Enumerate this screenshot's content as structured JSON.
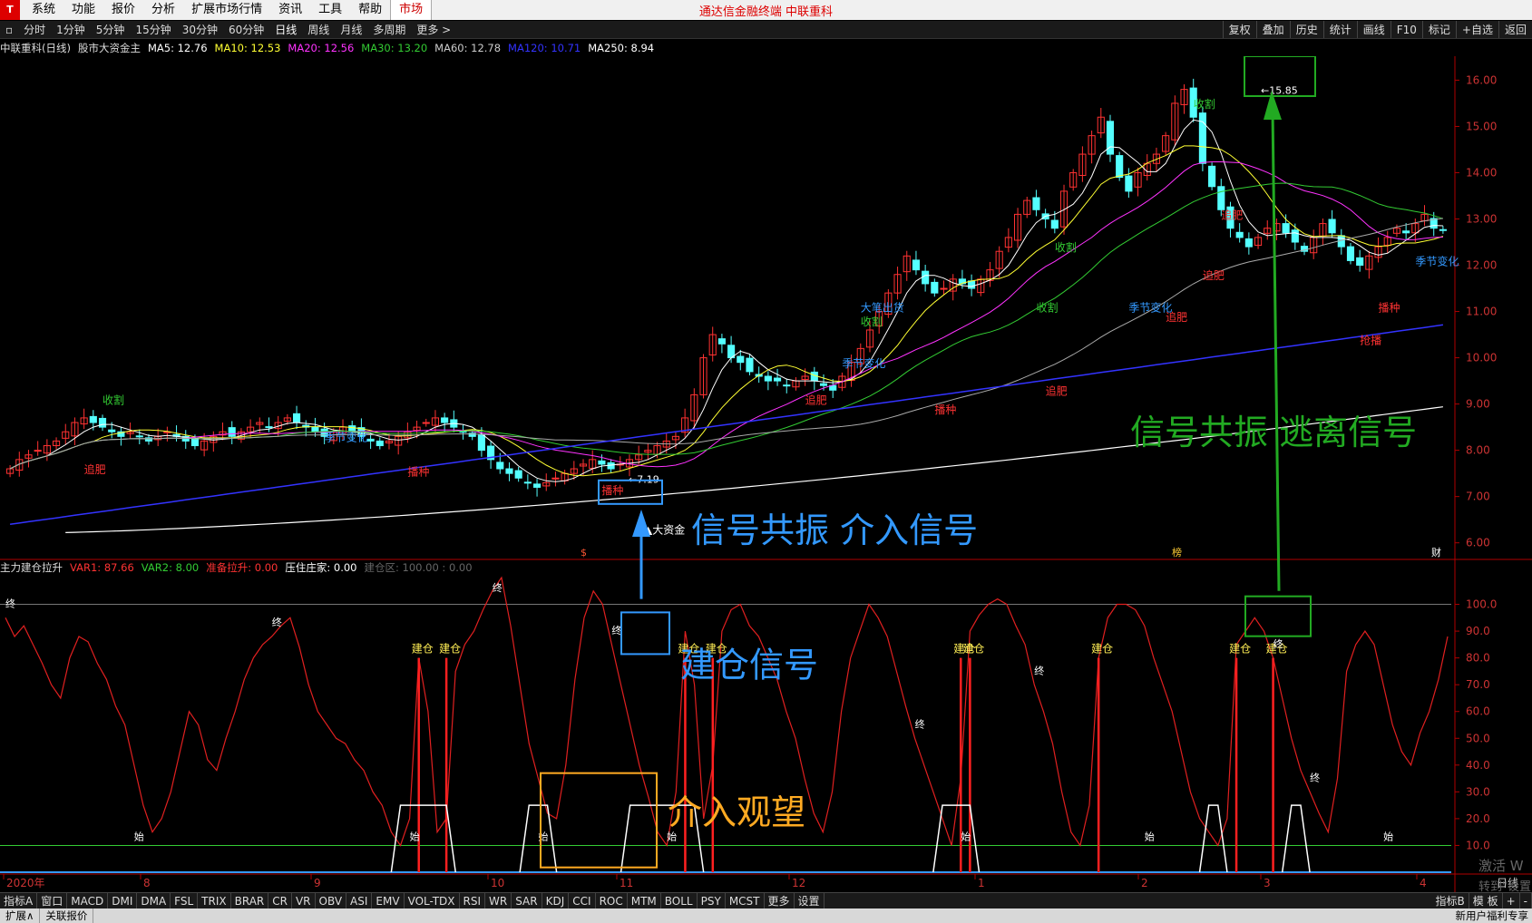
{
  "menu": {
    "items": [
      "系统",
      "功能",
      "报价",
      "分析",
      "扩展市场行情",
      "资讯",
      "工具",
      "帮助"
    ],
    "active": "市场",
    "title": "通达信金融终端  中联重科"
  },
  "periods": {
    "items": [
      "分时",
      "1分钟",
      "5分钟",
      "15分钟",
      "30分钟",
      "60分钟",
      "日线",
      "周线",
      "月线",
      "多周期",
      "更多 >"
    ],
    "active": "日线",
    "right": [
      "复权",
      "叠加",
      "历史",
      "统计",
      "画线",
      "F10",
      "标记",
      "+自选",
      "返回"
    ]
  },
  "main_info": {
    "stock": "中联重科(日线)",
    "indicator": "股市大资金主",
    "ma": [
      {
        "label": "MA5: 12.76",
        "color": "#ffffff"
      },
      {
        "label": "MA10: 12.53",
        "color": "#ffff33"
      },
      {
        "label": "MA20: 12.56",
        "color": "#ff33ff"
      },
      {
        "label": "MA30: 13.20",
        "color": "#33cc33"
      },
      {
        "label": "MA60: 12.78",
        "color": "#cccccc"
      },
      {
        "label": "MA120: 10.71",
        "color": "#3333ff"
      },
      {
        "label": "MA250: 8.94",
        "color": "#ffffff"
      }
    ]
  },
  "ind_info": {
    "name": "主力建仓拉升",
    "vars": [
      {
        "label": "VAR1: 87.66",
        "color": "#ff3333"
      },
      {
        "label": "VAR2: 8.00",
        "color": "#33cc33"
      },
      {
        "label": "准备拉升: 0.00",
        "color": "#ff3333"
      },
      {
        "label": "压住庄家: 0.00",
        "color": "#ffffff"
      },
      {
        "label": "建仓区: 100.00 : 0.00",
        "color": "#666666"
      }
    ]
  },
  "chart_data": [
    {
      "type": "candlestick",
      "title": "中联重科(日线)",
      "ylim": [
        5.7,
        16.4
      ],
      "y_ticks": [
        "16.00",
        "15.00",
        "14.00",
        "13.00",
        "12.00",
        "11.00",
        "10.00",
        "9.00",
        "8.00",
        "7.00",
        "6.00"
      ],
      "x_ticks": [
        "2020年",
        "8",
        "9",
        "10",
        "11",
        "12",
        "1",
        "2",
        "3",
        "4"
      ],
      "close": [
        7.6,
        7.8,
        7.9,
        8.0,
        8.1,
        8.2,
        8.4,
        8.6,
        8.7,
        8.6,
        8.5,
        8.4,
        8.3,
        8.4,
        8.3,
        8.2,
        8.3,
        8.4,
        8.3,
        8.2,
        8.1,
        8.2,
        8.3,
        8.4,
        8.3,
        8.4,
        8.5,
        8.6,
        8.5,
        8.6,
        8.7,
        8.6,
        8.5,
        8.4,
        8.3,
        8.4,
        8.5,
        8.4,
        8.3,
        8.2,
        8.1,
        8.2,
        8.3,
        8.4,
        8.5,
        8.6,
        8.7,
        8.6,
        8.5,
        8.4,
        8.3,
        8.0,
        7.8,
        7.6,
        7.5,
        7.4,
        7.3,
        7.2,
        7.3,
        7.4,
        7.5,
        7.6,
        7.7,
        7.8,
        7.7,
        7.6,
        7.7,
        7.8,
        7.9,
        8.0,
        8.1,
        8.2,
        8.3,
        8.7,
        9.2,
        10.0,
        10.5,
        10.3,
        10.0,
        9.9,
        9.7,
        9.6,
        9.5,
        9.5,
        9.4,
        9.5,
        9.6,
        9.5,
        9.4,
        9.3,
        9.6,
        9.9,
        10.2,
        10.6,
        11.0,
        11.4,
        11.8,
        12.2,
        11.9,
        11.6,
        11.4,
        11.5,
        11.7,
        11.6,
        11.5,
        11.7,
        11.9,
        12.3,
        12.6,
        13.1,
        13.4,
        13.2,
        13.0,
        12.8,
        13.6,
        14.0,
        14.4,
        14.8,
        15.2,
        14.4,
        13.9,
        13.6,
        14.0,
        14.2,
        14.4,
        14.8,
        15.5,
        15.8,
        15.2,
        14.2,
        13.7,
        13.2,
        12.8,
        12.6,
        12.4,
        12.6,
        12.8,
        12.9,
        12.7,
        12.5,
        12.3,
        12.6,
        12.9,
        12.7,
        12.4,
        12.1,
        12.0,
        12.2,
        12.4,
        12.6,
        12.8,
        12.7,
        12.9,
        13.1,
        12.8,
        12.76
      ],
      "ma_series": [
        "MA5",
        "MA10",
        "MA20",
        "MA30",
        "MA60",
        "MA120",
        "MA250"
      ],
      "labels": [
        "收割",
        "追肥",
        "播种",
        "季节变化",
        "大笔出货",
        "大资金",
        "抢播",
        "7.19",
        "15.85"
      ],
      "bottom_markers": [
        "$",
        "榜",
        "财"
      ]
    },
    {
      "type": "line",
      "title": "主力建仓拉升",
      "ylim": [
        0,
        110
      ],
      "y_ticks": [
        "100.0",
        "90.0",
        "80.0",
        "70.0",
        "60.0",
        "50.0",
        "40.0",
        "30.0",
        "20.0",
        "10.0"
      ],
      "var1": [
        95,
        88,
        92,
        85,
        78,
        70,
        65,
        80,
        88,
        86,
        78,
        72,
        62,
        55,
        40,
        25,
        15,
        20,
        30,
        45,
        60,
        55,
        42,
        38,
        50,
        60,
        72,
        80,
        85,
        88,
        92,
        95,
        84,
        70,
        60,
        55,
        50,
        48,
        42,
        38,
        30,
        25,
        15,
        10,
        20,
        80,
        60,
        15,
        20,
        75,
        85,
        90,
        98,
        105,
        110,
        92,
        70,
        48,
        35,
        22,
        20,
        40,
        72,
        95,
        105,
        100,
        85,
        70,
        55,
        40,
        28,
        15,
        10,
        30,
        90,
        70,
        20,
        40,
        90,
        98,
        100,
        92,
        88,
        80,
        72,
        60,
        50,
        35,
        22,
        15,
        30,
        60,
        80,
        90,
        100,
        95,
        88,
        75,
        62,
        50,
        40,
        30,
        20,
        10,
        35,
        90,
        96,
        100,
        102,
        100,
        92,
        85,
        70,
        60,
        48,
        30,
        15,
        10,
        25,
        80,
        95,
        100,
        100,
        98,
        92,
        80,
        70,
        60,
        45,
        30,
        20,
        15,
        10,
        20,
        85,
        90,
        95,
        90,
        80,
        65,
        50,
        38,
        30,
        22,
        15,
        35,
        75,
        85,
        90,
        85,
        70,
        55,
        45,
        40,
        52,
        60,
        72,
        88
      ],
      "markers": [
        "终",
        "建仓",
        "始"
      ]
    }
  ],
  "annotations": {
    "entry_signal": "信号共振 介入信号",
    "exit_signal": "信号共振 逃离信号",
    "build_signal": "建仓信号",
    "watch": "介入观望",
    "low_price": "7.19",
    "high_price": "15.85"
  },
  "indicator_tabs": [
    "指标A",
    "窗口",
    "MACD",
    "DMI",
    "DMA",
    "FSL",
    "TRIX",
    "BRAR",
    "CR",
    "VR",
    "OBV",
    "ASI",
    "EMV",
    "VOL-TDX",
    "RSI",
    "WR",
    "SAR",
    "KDJ",
    "CCI",
    "ROC",
    "MTM",
    "BOLL",
    "PSY",
    "MCST",
    "更多",
    "设置"
  ],
  "indicator_tabs_right": [
    "指标B",
    "模 板",
    "+",
    "-"
  ],
  "status": {
    "left": [
      "扩展∧",
      "关联报价"
    ],
    "right": "新用户福利专享"
  },
  "watermark": {
    "line1": "激活 W",
    "line2": "转到\"设置"
  },
  "side_label": "日线"
}
